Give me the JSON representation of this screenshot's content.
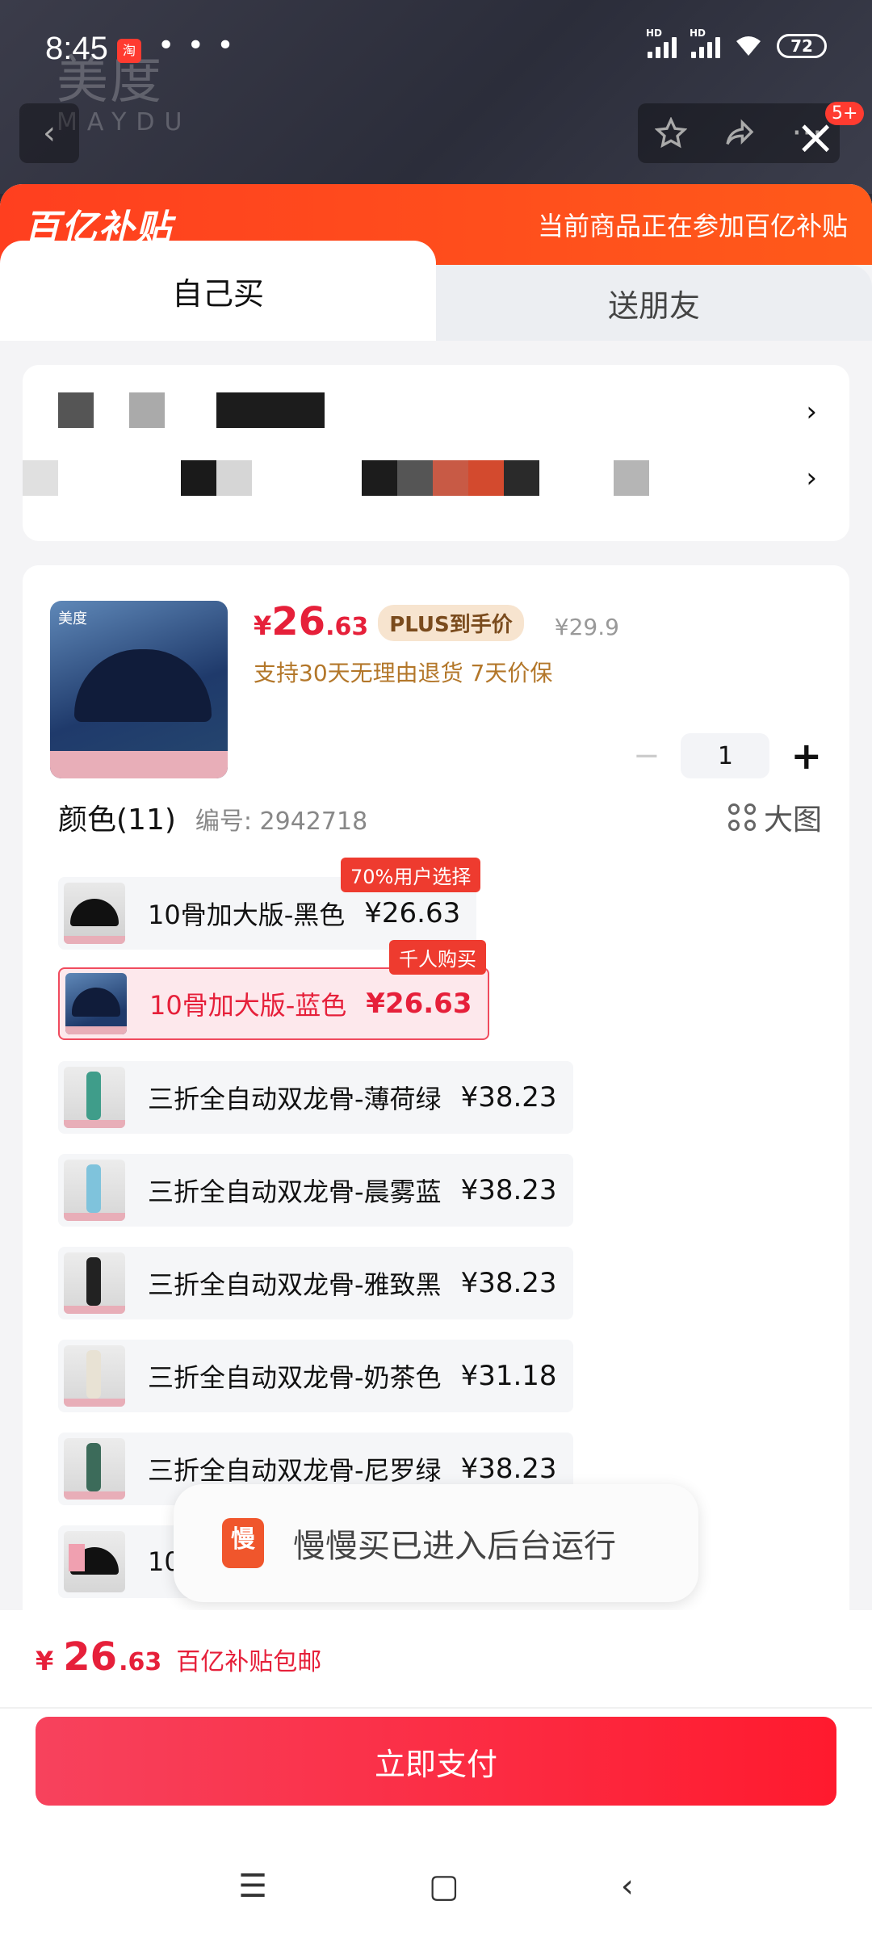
{
  "status_bar": {
    "time": "8:45",
    "app_badge": "淘",
    "dots": "• • •",
    "hd1": "HD",
    "hd2": "HD",
    "battery": "72"
  },
  "brand_watermark": {
    "cn": "美度",
    "en": "MAYDU"
  },
  "top_actions": {
    "back_icon": "chevron-left-icon",
    "star_icon": "star-icon",
    "share_icon": "share-icon",
    "more": "···",
    "badge": "5+",
    "close": "×"
  },
  "subsidy": {
    "logo": "百亿补贴",
    "note": "当前商品正在参加百亿补贴"
  },
  "tabs": [
    {
      "label": "自己买"
    },
    {
      "label": "送朋友"
    }
  ],
  "address": {
    "arrow1": "›",
    "arrow2": "›"
  },
  "product": {
    "thumb_brand": "美度",
    "price_symbol": "¥",
    "price_int": "26",
    "price_dec": ".63",
    "plus_tag": "PLUS到手价",
    "original_price": "¥29.9",
    "guarantee": "支持30天无理由退货 7天价保",
    "qty_minus": "−",
    "qty_value": "1",
    "qty_plus": "+"
  },
  "colors": {
    "title": "颜色(11)",
    "code": "编号: 2942718",
    "big_image": "大图",
    "items": [
      {
        "label": "10骨加大版-黑色",
        "price": "¥26.63",
        "tag": "70%用户选择"
      },
      {
        "label": "10骨加大版-蓝色",
        "price": "¥26.63",
        "tag": "千人购买"
      },
      {
        "label": "三折全自动双龙骨-薄荷绿",
        "price": "¥38.23",
        "tag": ""
      },
      {
        "label": "三折全自动双龙骨-晨雾蓝",
        "price": "¥38.23",
        "tag": ""
      },
      {
        "label": "三折全自动双龙骨-雅致黑",
        "price": "¥38.23",
        "tag": ""
      },
      {
        "label": "三折全自动双龙骨-奶茶色",
        "price": "¥31.18",
        "tag": ""
      },
      {
        "label": "三折全自动双龙骨-尼罗绿",
        "price": "¥38.23",
        "tag": ""
      },
      {
        "label": "10",
        "price": "",
        "tag": ""
      }
    ]
  },
  "toast": {
    "icon": "慢",
    "text": "慢慢买已进入后台运行"
  },
  "bottom": {
    "price_symbol": "¥",
    "price_int": "26",
    "price_dec": ".63",
    "note": "百亿补贴包邮",
    "pay_label": "立即支付"
  },
  "navbar": {
    "menu": "☰",
    "home": "▢",
    "back": "‹"
  }
}
